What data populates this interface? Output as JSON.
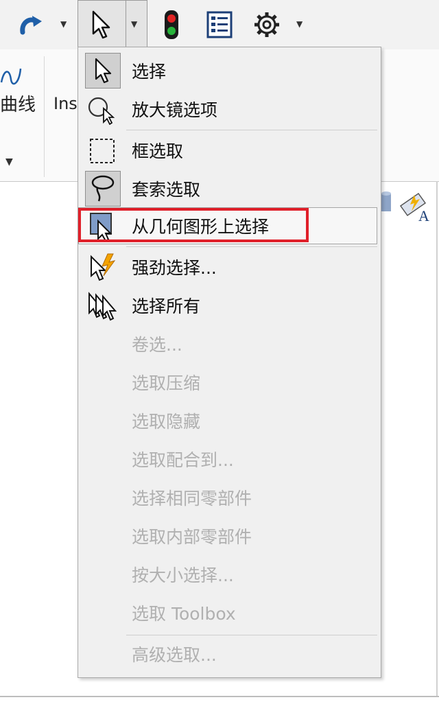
{
  "ribbon": {
    "curve_label_fragment": "曲线",
    "insert_label_fragment": "Ins"
  },
  "menu": {
    "items": [
      {
        "label": "选择",
        "icon": "arrow-pointer-icon",
        "enabled": true
      },
      {
        "label": "放大镜选项",
        "icon": "magnifier-pointer-icon",
        "enabled": true
      },
      {
        "label": "框选取",
        "icon": "box-select-icon",
        "enabled": true
      },
      {
        "label": "套索选取",
        "icon": "lasso-icon",
        "enabled": true
      },
      {
        "label": "从几何图形上选择",
        "icon": "select-on-geometry-icon",
        "enabled": true,
        "highlighted": true
      },
      {
        "label": "强劲选择...",
        "icon": "power-select-icon",
        "enabled": true
      },
      {
        "label": "选择所有",
        "icon": "select-all-icon",
        "enabled": true
      },
      {
        "label": "卷选...",
        "enabled": false
      },
      {
        "label": "选取压缩",
        "enabled": false
      },
      {
        "label": "选取隐藏",
        "enabled": false
      },
      {
        "label": "选取配合到...",
        "enabled": false
      },
      {
        "label": "选择相同零部件",
        "enabled": false
      },
      {
        "label": "选取内部零部件",
        "enabled": false
      },
      {
        "label": "按大小选择...",
        "enabled": false
      },
      {
        "label": "选取 Toolbox",
        "enabled": false
      },
      {
        "label": "高级选取...",
        "enabled": false
      }
    ]
  },
  "colors": {
    "highlight_outline": "#e0202a",
    "disabled_text": "#b0b0b0",
    "menu_background": "#f0f0f0"
  }
}
